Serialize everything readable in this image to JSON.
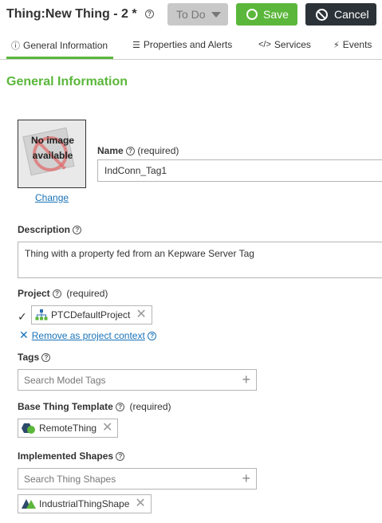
{
  "header": {
    "title": "Thing:New Thing - 2 *",
    "help_icon": "question-circle-icon",
    "todo_label": "To Do",
    "save_label": "Save",
    "cancel_label": "Cancel"
  },
  "tabs": [
    {
      "label": "General Information",
      "icon": "info-circle-icon",
      "icon_glyph": "ⓘ",
      "active": true
    },
    {
      "label": "Properties and Alerts",
      "icon": "list-icon",
      "icon_glyph": "☰",
      "active": false
    },
    {
      "label": "Services",
      "icon": "code-icon",
      "icon_glyph": "</>",
      "active": false
    },
    {
      "label": "Events",
      "icon": "lightning-icon",
      "icon_glyph": "⚡",
      "active": false
    }
  ],
  "section_title": "General Information",
  "image": {
    "placeholder_text": "No image available",
    "change_label": "Change"
  },
  "name": {
    "label": "Name",
    "required": "(required)",
    "value": "IndConn_Tag1"
  },
  "description": {
    "label": "Description",
    "value": "Thing with a property fed from an Kepware Server Tag"
  },
  "project": {
    "label": "Project",
    "required": "(required)",
    "value": "PTCDefaultProject",
    "remove_context_label": "Remove as project context"
  },
  "tags": {
    "label": "Tags",
    "placeholder": "Search Model Tags"
  },
  "base_template": {
    "label": "Base Thing Template",
    "required": "(required)",
    "value": "RemoteThing"
  },
  "shapes": {
    "label": "Implemented Shapes",
    "placeholder": "Search Thing Shapes",
    "value": "IndustrialThingShape"
  },
  "colors": {
    "accent": "#5bb73b",
    "link": "#1a73b8",
    "cancel_bg": "#2c3338",
    "todo_bg": "#c8c8c8"
  }
}
